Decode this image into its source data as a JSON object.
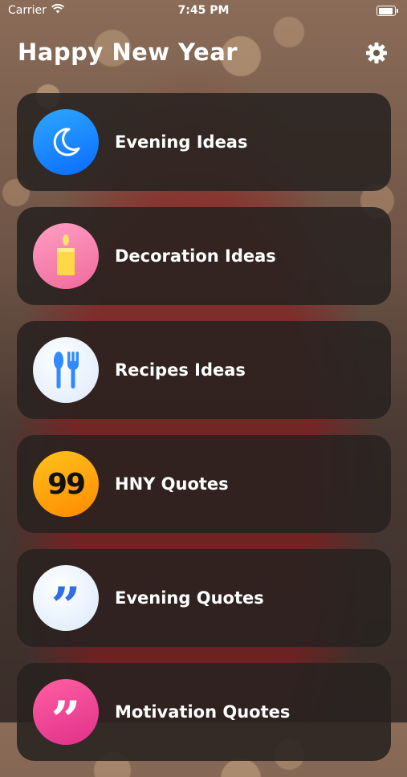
{
  "status_bar": {
    "carrier": "Carrier",
    "time": "7:45 PM",
    "icons": [
      "wifi-icon",
      "battery-icon"
    ]
  },
  "header": {
    "title": "Happy New Year",
    "settings_icon": "gear-icon"
  },
  "menu": {
    "items": [
      {
        "label": "Evening Ideas",
        "icon": "moon-icon",
        "color": "#1a8cff"
      },
      {
        "label": "Decoration Ideas",
        "icon": "candle-icon",
        "color": "#f37aa8"
      },
      {
        "label": "Recipes Ideas",
        "icon": "fork-spoon-icon",
        "color": "#2f8bff"
      },
      {
        "label": "HNY Quotes",
        "icon": "ninety-nine-icon",
        "color": "#ffa60f",
        "glyph": "99"
      },
      {
        "label": "Evening Quotes",
        "icon": "quote-icon",
        "color": "#2f6fe0",
        "glyph": "”"
      },
      {
        "label": "Motivation Quotes",
        "icon": "quote-icon",
        "color": "#e93b8f",
        "glyph": "”"
      }
    ]
  }
}
